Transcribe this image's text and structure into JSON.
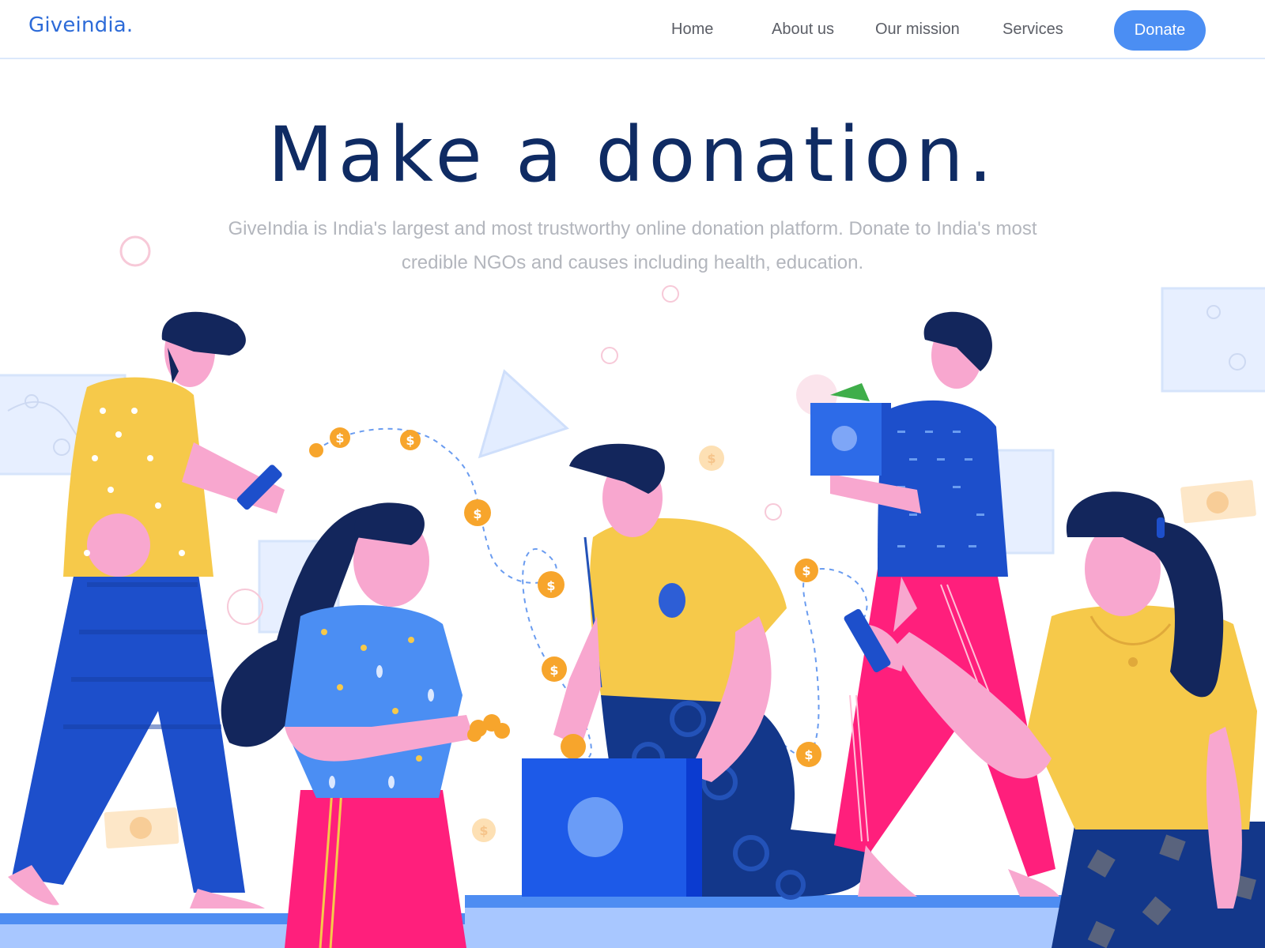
{
  "brand": {
    "logo_text": "Giveindia."
  },
  "nav": {
    "items": [
      {
        "label": "Home"
      },
      {
        "label": "About us"
      },
      {
        "label": "Our mission"
      },
      {
        "label": "Services"
      }
    ],
    "donate_label": "Donate"
  },
  "hero": {
    "title": "Make a donation.",
    "subtitle": "GiveIndia is India's largest and most trustworthy online donation platform. Donate to India's most credible NGOs and causes including health, education."
  },
  "colors": {
    "accent": "#4b8ef3",
    "title": "#0f2b63",
    "subtitle": "#b3b6bd",
    "yellow": "#f6c94a",
    "pink": "#ff1f7c",
    "blue": "#1d4fcb",
    "skin": "#f8a7cf"
  },
  "illustration": {
    "coin_symbol": "$",
    "icons": [
      "dollar-coin-icon",
      "phone-icon",
      "donation-box-icon",
      "banknote-icon"
    ]
  }
}
